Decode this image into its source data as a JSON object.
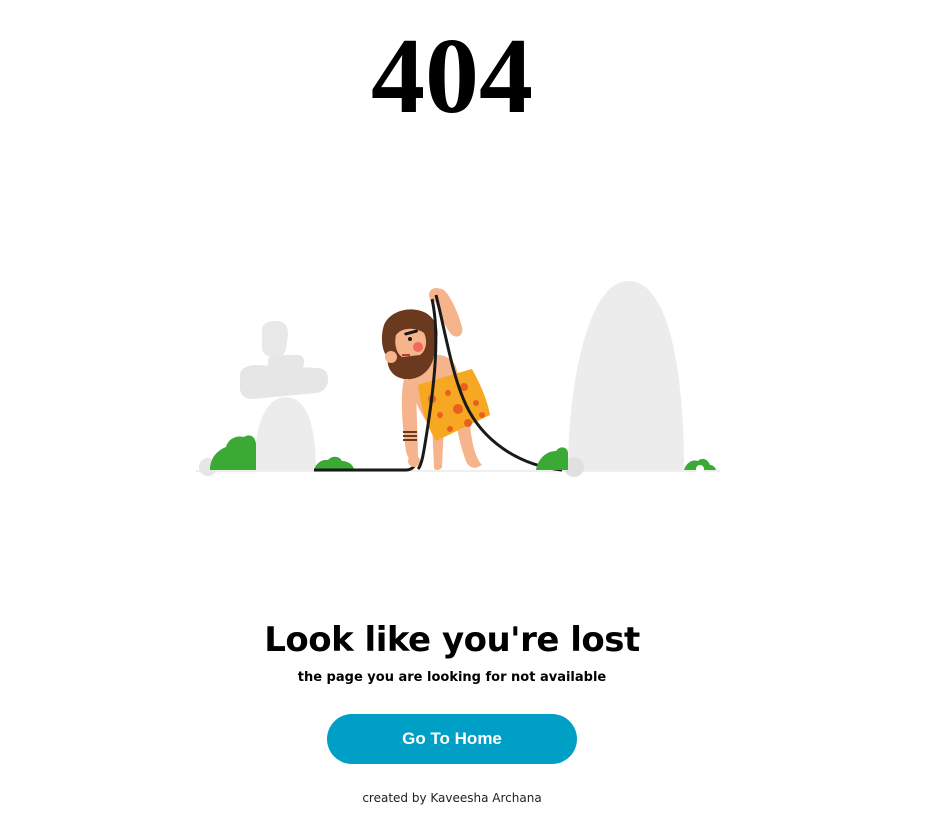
{
  "error": {
    "code": "404"
  },
  "illustration": {
    "subject": "caveman-with-cable-illustration"
  },
  "message": {
    "headline": "Look like you're lost",
    "subline": "the page you are looking for not available"
  },
  "actions": {
    "home_label": "Go To Home"
  },
  "footer": {
    "credit": "created by Kaveesha Archana"
  },
  "colors": {
    "button_bg": "#00a0c6",
    "button_text": "#ffffff",
    "rock": "#ececec",
    "bush": "#3aaa35",
    "skin": "#f6b48c",
    "hair": "#6b3a1e",
    "cloth": "#f7a823",
    "cloth_spots": "#e8601c",
    "cable": "#1a1a1a"
  }
}
